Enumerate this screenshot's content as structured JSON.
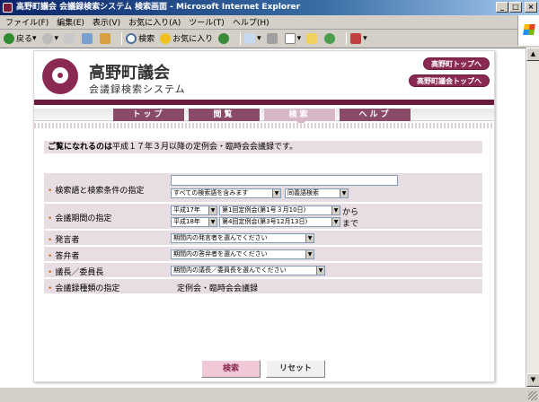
{
  "window": {
    "title": "高野町議会 会議録検索システム 検索画面 - Microsoft Internet Explorer",
    "min": "_",
    "max": "□",
    "close": "×"
  },
  "menu": [
    "ファイル(F)",
    "編集(E)",
    "表示(V)",
    "お気に入り(A)",
    "ツール(T)",
    "ヘルプ(H)"
  ],
  "toolbar": {
    "back": "戻る",
    "search": "検索",
    "favorites": "お気に入り"
  },
  "site": {
    "title": "高野町議会",
    "subtitle": "会議録検索システム",
    "link_town": "高野町トップへ",
    "link_council": "高野町議会トップへ"
  },
  "nav": {
    "top": "トップ",
    "browse": "閲覧",
    "search": "検索",
    "help": "ヘルプ"
  },
  "notice": {
    "bold": "ご覧になれるのは",
    "rest": "平成１７年３月以降の定例会・臨時会会議録です。"
  },
  "form": {
    "keyword_label": "検索語と検索条件の指定",
    "keyword_value": "",
    "keyword_mode": "すべての検索語を含みます",
    "synonym": "同義語検索",
    "period_label": "会議期間の指定",
    "from_year": "平成17年",
    "from_session": "第1回定例会(第1号３月10日)",
    "from_suffix": "から",
    "to_year": "平成18年",
    "to_session": "第4回定例会(第3号12月13日)",
    "to_suffix": "まで",
    "speaker_label": "発言者",
    "speaker_value": "期間内の発言者を選んでください",
    "answerer_label": "答弁者",
    "answerer_value": "期間内の答弁者を選んでください",
    "chair_label": "議長／委員長",
    "chair_value": "期間内の議長／委員長を選んでください",
    "type_label": "会議録種類の指定",
    "type_value": "定例会・臨時会会議録"
  },
  "buttons": {
    "search": "検索",
    "reset": "リセット"
  },
  "colors": {
    "brand": "#8a2a52",
    "row_bg": "#e8dde3",
    "active_tab": "#d8b8c8"
  }
}
